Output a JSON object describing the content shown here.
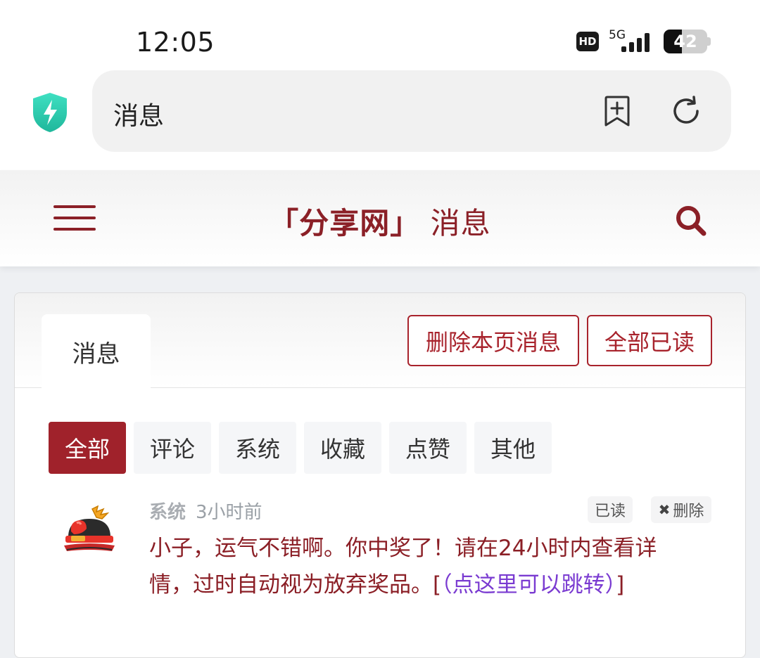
{
  "status": {
    "time": "12:05",
    "hd": "HD",
    "network": "5G",
    "battery": "42",
    "battery_level": 0.42
  },
  "browser": {
    "page_title": "消息",
    "bookmark_icon": "bookmark-add-icon",
    "reload_icon": "reload-icon",
    "shield_icon": "shield-bolt-icon"
  },
  "site": {
    "brand": "「分享网」",
    "title": "消息",
    "menu_icon": "hamburger-menu-icon",
    "search_icon": "search-icon"
  },
  "card": {
    "tab_label": "消息",
    "delete_page_label": "删除本页消息",
    "mark_all_read_label": "全部已读"
  },
  "filters": [
    {
      "label": "全部",
      "active": true
    },
    {
      "label": "评论",
      "active": false
    },
    {
      "label": "系统",
      "active": false
    },
    {
      "label": "收藏",
      "active": false
    },
    {
      "label": "点赞",
      "active": false
    },
    {
      "label": "其他",
      "active": false
    }
  ],
  "message": {
    "category": "系统",
    "time": "3小时前",
    "read_label": "已读",
    "delete_label": "删除",
    "text": "小子，运气不错啊。你中奖了！请在24小时内查看详情，过时自动视为放弃奖品。[",
    "link_text": "（点这里可以跳转）",
    "text_end": "]"
  },
  "colors": {
    "accent": "#a0222b",
    "brand_red": "#8b2027",
    "link": "#7a3bd1",
    "shield": "#2fd3b4"
  }
}
